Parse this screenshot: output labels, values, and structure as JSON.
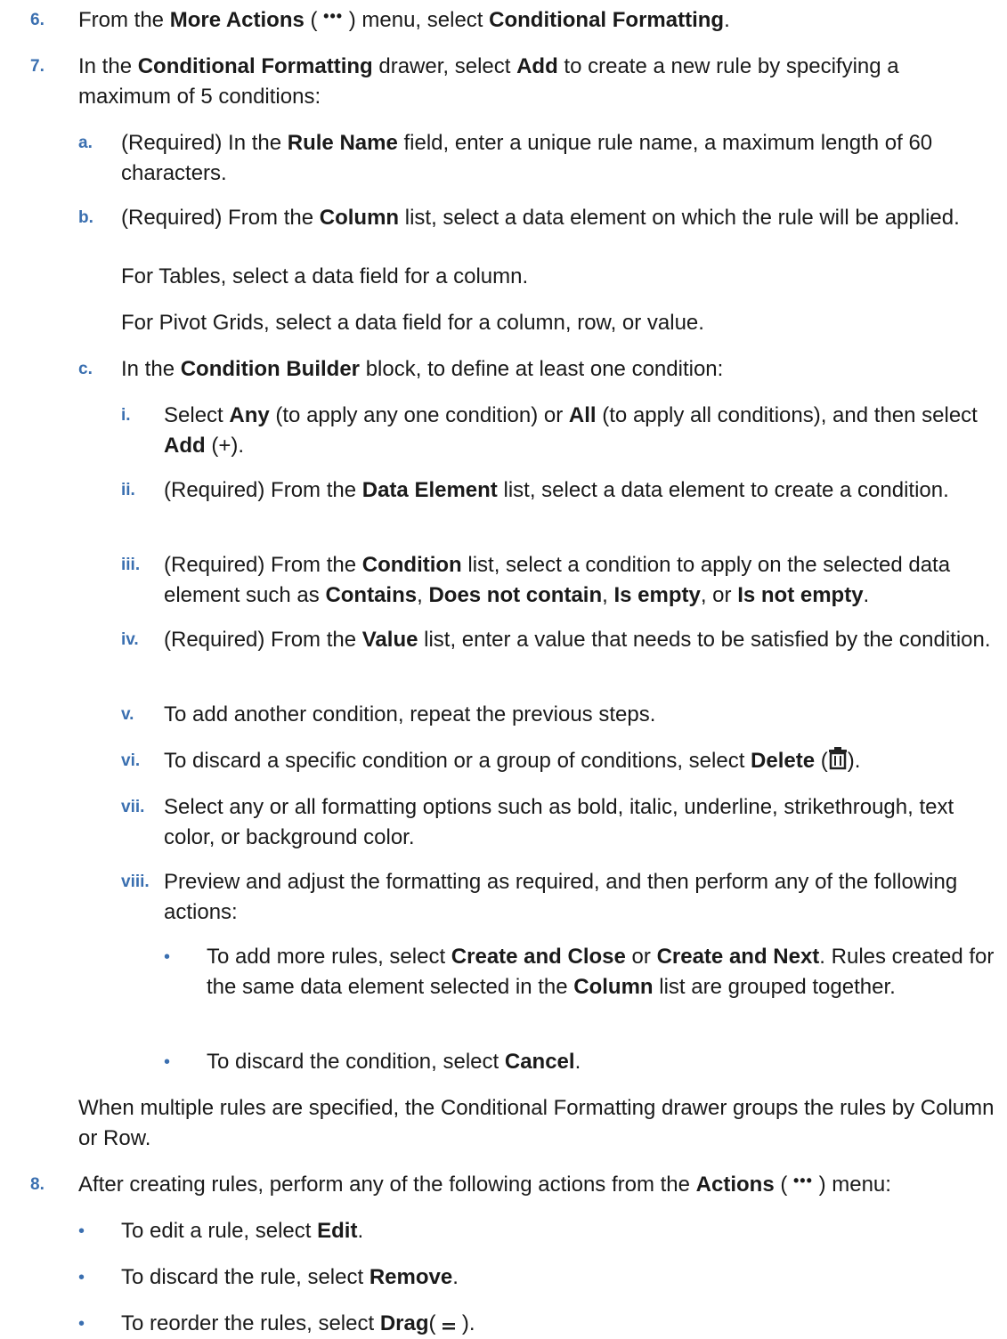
{
  "steps": {
    "s6": {
      "num": "6.",
      "t1": "From the ",
      "b1": "More Actions",
      "t2": " ( ",
      "t3": " ) menu, select ",
      "b2": "Conditional Formatting",
      "t4": "."
    },
    "s7": {
      "num": "7.",
      "t1": "In the ",
      "b1": "Conditional Formatting",
      "t2": " drawer, select ",
      "b2": "Add",
      "t3": " to create a new rule by specifying a maximum of 5 conditions:"
    },
    "a": {
      "num": "a.",
      "t1": "(Required) In the ",
      "b1": "Rule Name",
      "t2": " field, enter a unique rule name, a maximum length of 60 characters."
    },
    "b": {
      "num": "b.",
      "t1": "(Required) From the ",
      "b1": "Column",
      "t2": " list, select a data element on which the rule will be applied."
    },
    "b_p1": "For Tables, select a data field for a column.",
    "b_p2": "For Pivot Grids, select a data field for a column, row, or value.",
    "c": {
      "num": "c.",
      "t1": "In the ",
      "b1": "Condition Builder",
      "t2": " block, to define at least one condition:"
    },
    "i": {
      "num": "i.",
      "t1": "Select ",
      "b1": "Any",
      "t2": " (to apply any one condition) or ",
      "b2": "All",
      "t3": " (to apply all conditions), and then select ",
      "b3": "Add",
      "t4": " (+)."
    },
    "ii": {
      "num": "ii.",
      "t1": "(Required) From the ",
      "b1": "Data Element",
      "t2": " list, select a data element to create a condition."
    },
    "iii": {
      "num": "iii.",
      "t1": "(Required) From the ",
      "b1": "Condition",
      "t2": " list, select a condition to apply on the selected data element such as ",
      "b2": "Contains",
      "t3": ", ",
      "b3": "Does not contain",
      "t4": ", ",
      "b4": "Is empty",
      "t5": ", or ",
      "b5": "Is not empty",
      "t6": "."
    },
    "iv": {
      "num": "iv.",
      "t1": "(Required) From the ",
      "b1": "Value",
      "t2": " list, enter a value that needs to be satisfied by the condition."
    },
    "v": {
      "num": "v.",
      "t1": "To add another condition, repeat the previous steps."
    },
    "vi": {
      "num": "vi.",
      "t1": "To discard a specific condition or a group of conditions, select ",
      "b1": "Delete",
      "t2": " (",
      "t3": ")."
    },
    "vii": {
      "num": "vii.",
      "t1": "Select any or all formatting options such as bold, italic, underline, strikethrough, text color, or background color."
    },
    "viii": {
      "num": "viii.",
      "t1": "Preview and adjust the formatting as required, and then perform any of the following actions:"
    },
    "viii_b1": {
      "bullet": "•",
      "t1": "To add more rules, select ",
      "b1": "Create and Close",
      "t2": " or ",
      "b2": "Create and Next",
      "t3": ". Rules created for the same data element selected in the ",
      "b3": "Column",
      "t4": " list are grouped together."
    },
    "viii_b2": {
      "bullet": "•",
      "t1": "To discard the condition, select ",
      "b1": "Cancel",
      "t2": "."
    },
    "c_p": "When multiple rules are specified, the Conditional Formatting drawer groups the rules by Column or Row.",
    "s8": {
      "num": "8.",
      "t1": "After creating rules, perform any of the following actions from the ",
      "b1": "Actions",
      "t2": " ( ",
      "t3": " ) menu:"
    },
    "s8_b1": {
      "bullet": "•",
      "t1": "To edit a rule, select ",
      "b1": "Edit",
      "t2": "."
    },
    "s8_b2": {
      "bullet": "•",
      "t1": "To discard the rule, select ",
      "b1": "Remove",
      "t2": "."
    },
    "s8_b3": {
      "bullet": "•",
      "t1": "To reorder the rules, select ",
      "b1": "Drag",
      "t2": "( ",
      "t3": " )."
    }
  },
  "icons": {
    "more": "more-actions-icon",
    "delete": "delete-icon",
    "drag": "drag-icon"
  }
}
